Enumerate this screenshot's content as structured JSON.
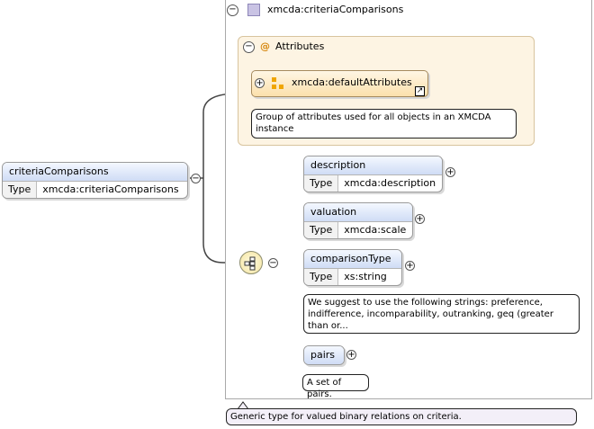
{
  "root": {
    "name": "criteriaComparisons",
    "type_key": "Type",
    "type_value": "xmcda:criteriaComparisons"
  },
  "complex_type": {
    "name": "xmcda:criteriaComparisons",
    "note": "Generic type for valued binary relations on criteria."
  },
  "attributes": {
    "title": "Attributes",
    "at_symbol": "@",
    "group_ref": "xmcda:defaultAttributes",
    "note": "Group of attributes used for all objects in an XMCDA instance"
  },
  "children": [
    {
      "name": "description",
      "type_key": "Type",
      "type_value": "xmcda:description"
    },
    {
      "name": "valuation",
      "type_key": "Type",
      "type_value": "xmcda:scale"
    },
    {
      "name": "comparisonType",
      "type_key": "Type",
      "type_value": "xs:string",
      "note": "We suggest to use the following strings: preference, indifference, incomparability, outranking, geq (greater than or..."
    },
    {
      "name": "pairs",
      "note": "A set of pairs."
    }
  ],
  "icons": {
    "collapse": "minus-toggle-icon",
    "expand": "plus-toggle-icon",
    "type": "complex-type-icon",
    "group": "attribute-group-icon",
    "link": "link-arrow-icon",
    "sequence": "sequence-compositor-icon"
  }
}
